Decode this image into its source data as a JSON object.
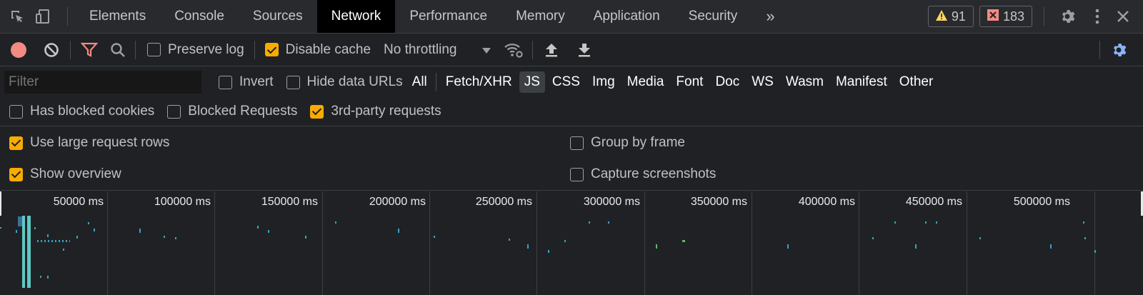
{
  "tabs": {
    "items": [
      {
        "label": "Elements"
      },
      {
        "label": "Console"
      },
      {
        "label": "Sources"
      },
      {
        "label": "Network",
        "active": true
      },
      {
        "label": "Performance"
      },
      {
        "label": "Memory"
      },
      {
        "label": "Application"
      },
      {
        "label": "Security"
      }
    ],
    "more_label": "»",
    "warnings_count": "91",
    "errors_count": "183"
  },
  "toolbar": {
    "preserve_log_label": "Preserve log",
    "preserve_log_checked": false,
    "disable_cache_label": "Disable cache",
    "disable_cache_checked": true,
    "throttling_value": "No throttling"
  },
  "filter": {
    "placeholder": "Filter",
    "invert_label": "Invert",
    "hide_data_urls_label": "Hide data URLs",
    "types": [
      "All",
      "Fetch/XHR",
      "JS",
      "CSS",
      "Img",
      "Media",
      "Font",
      "Doc",
      "WS",
      "Wasm",
      "Manifest",
      "Other"
    ],
    "selected_type": "JS",
    "has_blocked_cookies_label": "Has blocked cookies",
    "blocked_requests_label": "Blocked Requests",
    "third_party_label": "3rd-party requests",
    "third_party_checked": true
  },
  "settings": {
    "large_rows_label": "Use large request rows",
    "large_rows_checked": true,
    "show_overview_label": "Show overview",
    "show_overview_checked": true,
    "group_by_frame_label": "Group by frame",
    "group_by_frame_checked": false,
    "capture_screenshots_label": "Capture screenshots",
    "capture_screenshots_checked": false
  },
  "overview": {
    "ticks": [
      "50000 ms",
      "100000 ms",
      "150000 ms",
      "200000 ms",
      "250000 ms",
      "300000 ms",
      "350000 ms",
      "400000 ms",
      "450000 ms",
      "500000 ms"
    ]
  },
  "colors": {
    "accent_checkbox": "#f9ab00",
    "record_button": "#f28b82",
    "filter_icon": "#f28b82",
    "warning": "#fdd663",
    "error": "#f28b82",
    "settings_blue": "#8ab4f8",
    "timeline_mark": "#38a3c0"
  }
}
